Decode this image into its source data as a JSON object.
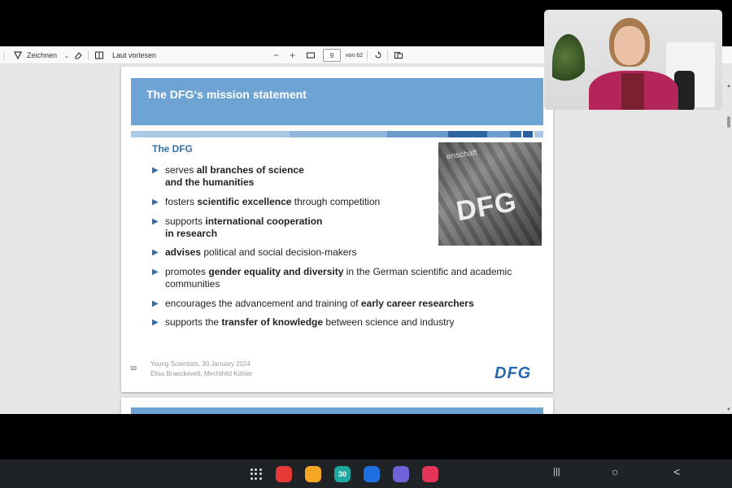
{
  "toolbar": {
    "draw_label": "Zeichnen",
    "read_aloud_label": "Laut vorlesen",
    "page_current": "9",
    "page_total": "von 62",
    "zoom_out": "−",
    "zoom_in": "+"
  },
  "slide": {
    "title": "The DFG‘s mission statement",
    "heading": "The DFG",
    "bullets": [
      {
        "parts": [
          {
            "t": "serves "
          },
          {
            "t": "all branches of science",
            "b": true
          }
        ],
        "line2": [
          {
            "t": "and the humanities",
            "b": true
          }
        ]
      },
      {
        "parts": [
          {
            "t": "fosters "
          },
          {
            "t": "scientific excellence",
            "b": true
          },
          {
            "t": " through competition"
          }
        ]
      },
      {
        "parts": [
          {
            "t": "supports "
          },
          {
            "t": "international cooperation",
            "b": true
          }
        ],
        "line2": [
          {
            "t": "in research",
            "b": true
          }
        ]
      },
      {
        "parts": [
          {
            "t": "advises",
            "b": true
          },
          {
            "t": " political and social decision-makers"
          }
        ]
      },
      {
        "parts": [
          {
            "t": "promotes "
          },
          {
            "t": "gender equality and diversity",
            "b": true
          },
          {
            "t": " in the German scientific and academic"
          }
        ],
        "line2": [
          {
            "t": "communities"
          }
        ]
      },
      {
        "parts": [
          {
            "t": "encourages the advancement and training of "
          },
          {
            "t": "early career researchers",
            "b": true
          }
        ]
      },
      {
        "parts": [
          {
            "t": "supports the "
          },
          {
            "t": "transfer of knowledge",
            "b": true
          },
          {
            "t": " between science and industry"
          }
        ]
      }
    ],
    "photo_text_top": "enschaft",
    "photo_text_logo": "DFG",
    "slide_number": "10",
    "footer_line1": "Young Scientists, 30 January 2024",
    "footer_line2": "Elisa Braeckevelt, Mechthild Köhler",
    "logo": "DFG"
  },
  "taskbar": {
    "apps": [
      {
        "name": "flipboard-app-icon",
        "color": "#e53935"
      },
      {
        "name": "files-app-icon",
        "color": "#f5a623"
      },
      {
        "name": "calendar-app-icon",
        "color": "#1fa8a0",
        "label": "30"
      },
      {
        "name": "messages-app-icon",
        "color": "#1e6fe0"
      },
      {
        "name": "internet-app-icon",
        "color": "#6f62d8"
      },
      {
        "name": "screen-recorder-app-icon",
        "color": "#e4345a"
      }
    ],
    "nav": {
      "recents": "|||",
      "home": "○",
      "back": "<"
    }
  },
  "colors": {
    "slide_header": "#6ea4d4",
    "heading_blue": "#3471a8",
    "logo_blue": "#2667b0"
  }
}
